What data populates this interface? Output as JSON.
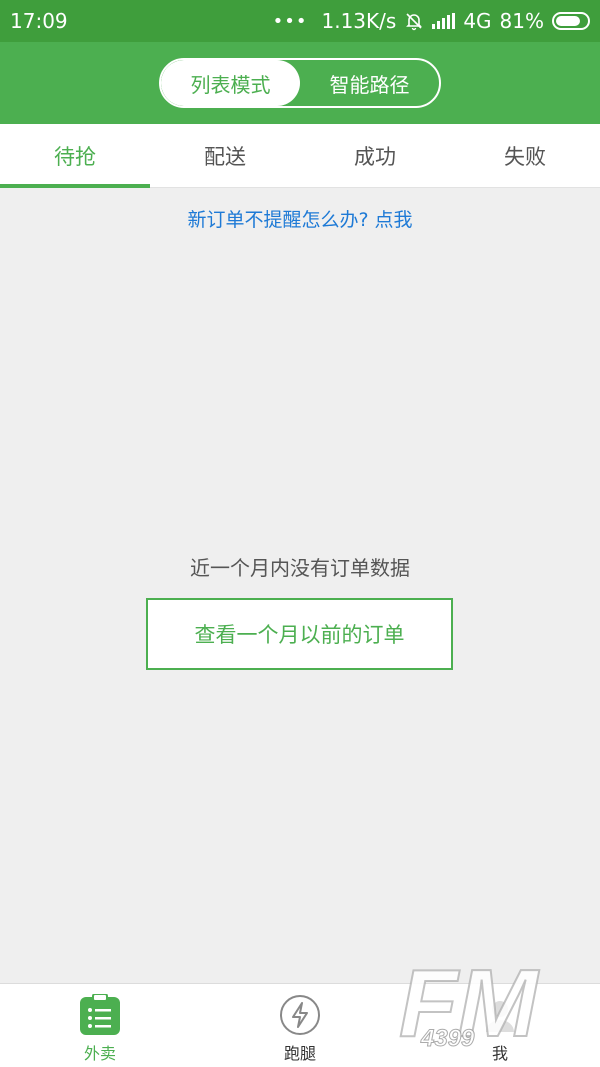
{
  "status_bar": {
    "time": "17:09",
    "net_speed": "1.13K/s",
    "network": "4G",
    "battery": "81%"
  },
  "segment": {
    "options": [
      {
        "label": "列表模式",
        "active": true
      },
      {
        "label": "智能路径",
        "active": false
      }
    ]
  },
  "tabs": [
    {
      "label": "待抢",
      "active": true
    },
    {
      "label": "配送",
      "active": false
    },
    {
      "label": "成功",
      "active": false
    },
    {
      "label": "失败",
      "active": false
    }
  ],
  "tip_link": "新订单不提醒怎么办? 点我",
  "empty_state": {
    "message": "近一个月内没有订单数据",
    "button_label": "查看一个月以前的订单"
  },
  "bottom_nav": [
    {
      "label": "外卖",
      "icon": "list-icon",
      "active": true
    },
    {
      "label": "跑腿",
      "icon": "lightning-icon",
      "active": false
    },
    {
      "label": "我",
      "icon": "user-icon",
      "active": false
    }
  ],
  "watermark": "FM 4399",
  "colors": {
    "primary": "#4caf50",
    "status_bar": "#3f9e3c",
    "link": "#1e7ad6",
    "background": "#efefef"
  }
}
